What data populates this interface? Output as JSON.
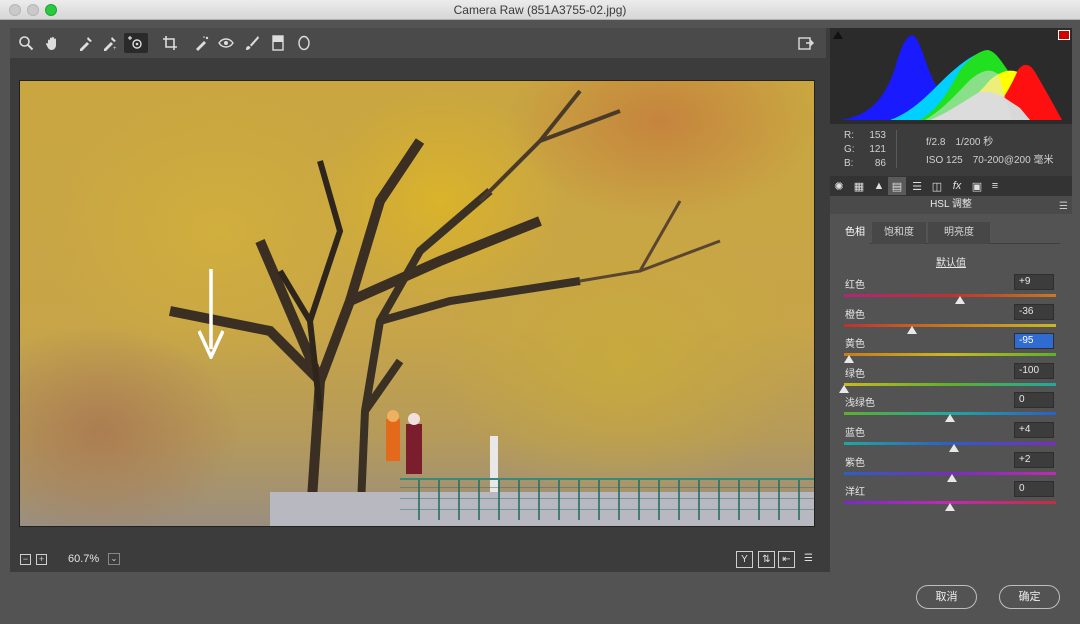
{
  "window": {
    "title": "Camera Raw (851A3755-02.jpg)"
  },
  "toolbar": {
    "tools": [
      "zoom-tool",
      "hand-tool",
      "white-balance-tool",
      "color-sampler-tool",
      "targeted-adjustment-tool",
      "crop-tool",
      "spot-removal-tool",
      "red-eye-tool",
      "adjustment-brush-tool",
      "graduated-filter-tool",
      "radial-filter-tool"
    ],
    "selected_tool": "targeted-adjustment-tool"
  },
  "status": {
    "zoom": "60.7%"
  },
  "histogram": {
    "clip_warning_left": "off",
    "clip_warning_right": "on",
    "clip_right_color": "#d10000"
  },
  "readout": {
    "r_label": "R:",
    "r_value": "153",
    "g_label": "G:",
    "g_value": "121",
    "b_label": "B:",
    "b_value": "86",
    "aperture": "f/2.8",
    "shutter": "1/200 秒",
    "iso": "ISO 125",
    "lens": "70-200@200 毫米"
  },
  "panel": {
    "title": "HSL 调整",
    "tabs": [
      "色相",
      "饱和度",
      "明亮度"
    ],
    "selected_tab": "色相",
    "default_link": "默认值",
    "sliders": [
      {
        "label": "红色",
        "value": "+9",
        "level": 9
      },
      {
        "label": "橙色",
        "value": "-36",
        "level": -36
      },
      {
        "label": "黄色",
        "value": "-95",
        "level": -95,
        "selected": true
      },
      {
        "label": "绿色",
        "value": "-100",
        "level": -100
      },
      {
        "label": "浅绿色",
        "value": "0",
        "level": 0
      },
      {
        "label": "蓝色",
        "value": "+4",
        "level": 4
      },
      {
        "label": "紫色",
        "value": "+2",
        "level": 2
      },
      {
        "label": "洋红",
        "value": "0",
        "level": 0
      }
    ]
  },
  "buttons": {
    "cancel": "取消",
    "ok": "确定"
  }
}
